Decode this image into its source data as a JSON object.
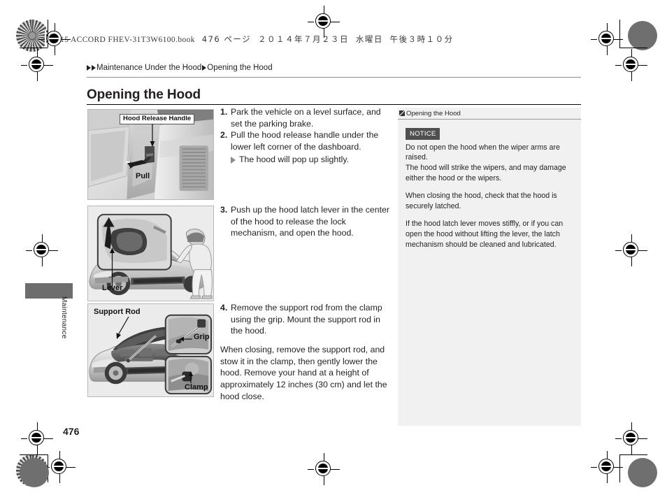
{
  "print_slug": {
    "book": "15 ACCORD FHEV-31T3W6100.book",
    "page_label": "476 ページ",
    "date": "２０１４年７月２３日",
    "weekday": "水曜日",
    "time": "午後３時１０分"
  },
  "breadcrumb": {
    "level1": "Maintenance Under the Hood",
    "level2": "Opening the Hood"
  },
  "title": "Opening the Hood",
  "thumb_tab": {
    "label": "Maintenance"
  },
  "page_number": "476",
  "figures": [
    {
      "id": "fig1",
      "caption_label": "Hood Release Handle",
      "action_label": "Pull"
    },
    {
      "id": "fig2",
      "caption_label": "Lever"
    },
    {
      "id": "fig3",
      "caption_label": "Support Rod",
      "inset_top_label": "Grip",
      "inset_bottom_label": "Clamp"
    }
  ],
  "steps": [
    {
      "number": "1.",
      "text": "Park the vehicle on a level surface, and set the parking brake."
    },
    {
      "number": "2.",
      "text": "Pull the hood release handle under the lower left corner of the dashboard.",
      "sub": "The hood will pop up slightly."
    },
    {
      "number": "3.",
      "text": "Push up the hood latch lever in the center of the hood to release the lock mechanism, and open the hood."
    },
    {
      "number": "4.",
      "text": "Remove the support rod from the clamp using the grip. Mount the support rod in the hood."
    }
  ],
  "closing_paragraph": "When closing, remove the support rod, and stow it in the clamp, then gently lower the hood. Remove your hand at a height of approximately 12 inches (30 cm) and let the hood close.",
  "side_panel": {
    "header": "Opening the Hood",
    "notice_badge": "NOTICE",
    "paragraphs": [
      "Do not open the hood when the wiper arms are raised.",
      "The hood will strike the wipers, and may damage either the hood or the wipers.",
      "When closing the hood, check that the hood is securely latched.",
      "If the hood latch lever moves stiffly, or if you can open the hood without lifting the lever, the latch mechanism should be cleaned and lubricated."
    ]
  },
  "colors": {
    "panel_bg": "#f1f1f1",
    "notice_badge_bg": "#4f4f4f",
    "thumb_tab": "#6d6d6d",
    "text": "#231f20"
  }
}
